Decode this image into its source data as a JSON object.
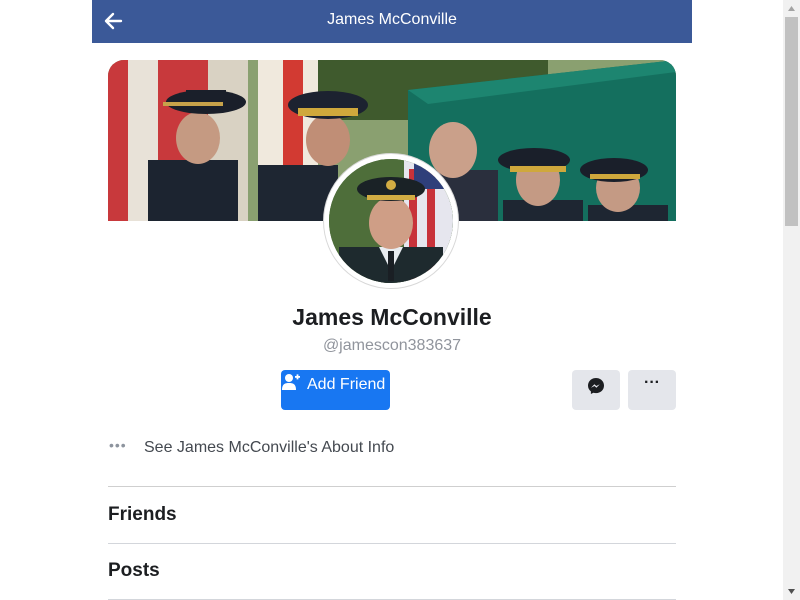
{
  "header": {
    "title": "James McConville",
    "back_icon": "arrow-left-icon",
    "background": "#3b5998"
  },
  "profile": {
    "name": "James McConville",
    "handle": "@jamescon383637"
  },
  "actions": {
    "add_friend_label": "Add Friend",
    "add_friend_icon": "add-friend-icon",
    "add_friend_color": "#1877f2",
    "message_icon": "messenger-icon",
    "more_label": "···",
    "more_icon": "more-options-icon"
  },
  "about": {
    "icon_glyph": "•••",
    "label": "See James McConville's About Info"
  },
  "sections": [
    {
      "title": "Friends"
    },
    {
      "title": "Posts"
    }
  ]
}
